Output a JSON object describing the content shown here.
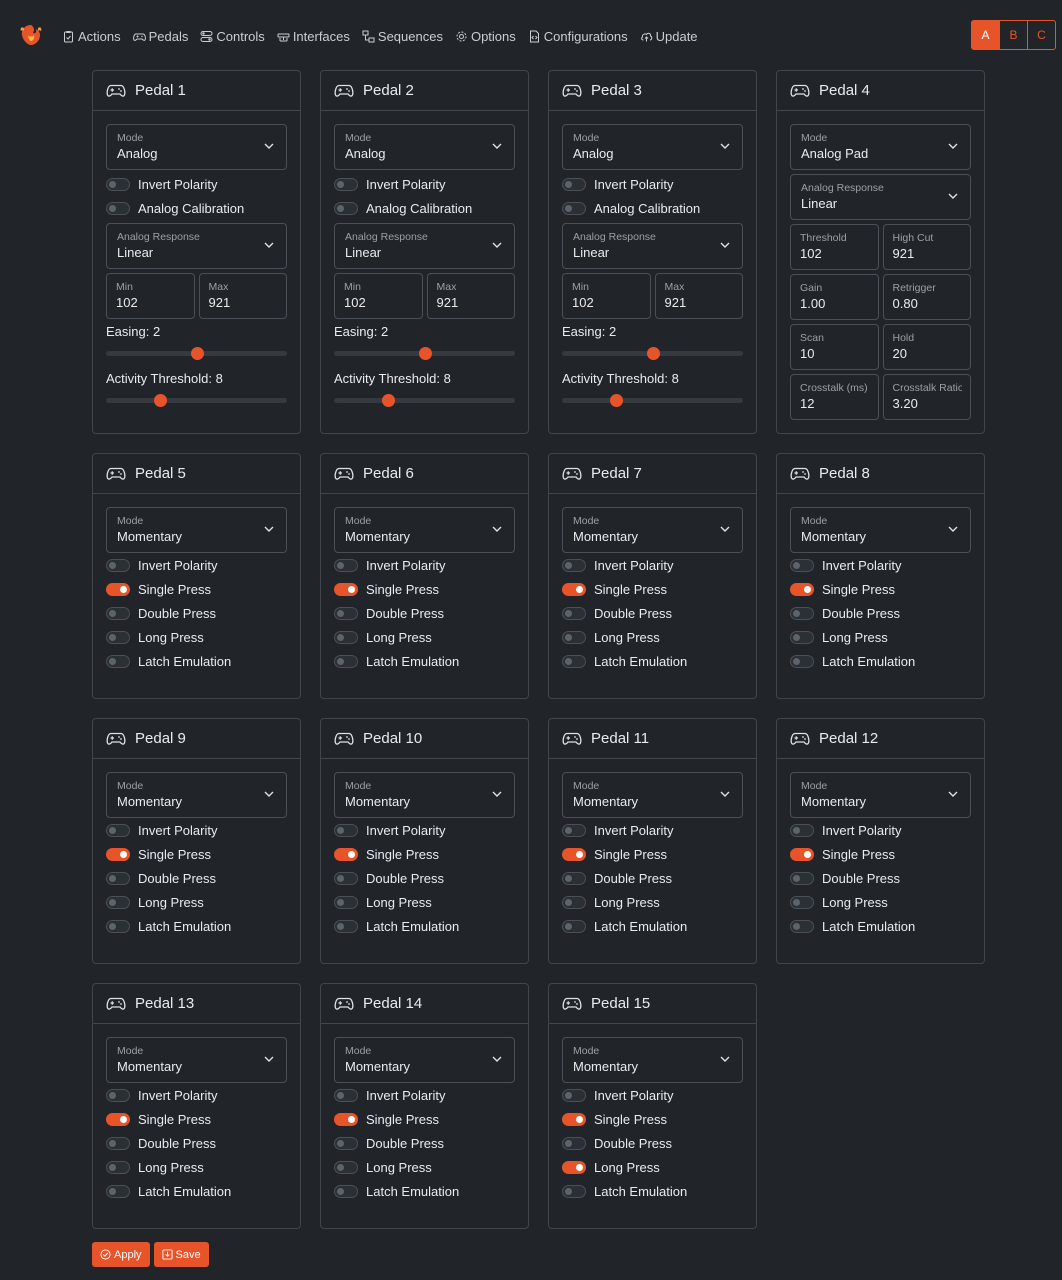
{
  "nav": {
    "items": [
      {
        "label": "Actions",
        "icon": "clipboard-icon"
      },
      {
        "label": "Pedals",
        "icon": "gamepad-icon"
      },
      {
        "label": "Controls",
        "icon": "toggles-icon"
      },
      {
        "label": "Interfaces",
        "icon": "router-icon"
      },
      {
        "label": "Sequences",
        "icon": "diagram-icon"
      },
      {
        "label": "Options",
        "icon": "gear-icon"
      },
      {
        "label": "Configurations",
        "icon": "file-code-icon"
      },
      {
        "label": "Update",
        "icon": "cloud-upload-icon"
      }
    ],
    "profiles": [
      "A",
      "B",
      "C"
    ],
    "active_profile": "A"
  },
  "accent_color": "#e8542a",
  "pedals": [
    {
      "title": "Pedal 1",
      "mode_label": "Mode",
      "mode": "Analog",
      "switches": [
        {
          "label": "Invert Polarity",
          "on": false
        },
        {
          "label": "Analog Calibration",
          "on": false
        }
      ],
      "response_label": "Analog Response",
      "response": "Linear",
      "min_label": "Min",
      "min": "102",
      "max_label": "Max",
      "max": "921",
      "easing_label": "Easing: 2",
      "easing": 0.5,
      "activity_label": "Activity Threshold: 8",
      "activity": 0.3
    },
    {
      "title": "Pedal 2",
      "mode_label": "Mode",
      "mode": "Analog",
      "switches": [
        {
          "label": "Invert Polarity",
          "on": false
        },
        {
          "label": "Analog Calibration",
          "on": false
        }
      ],
      "response_label": "Analog Response",
      "response": "Linear",
      "min_label": "Min",
      "min": "102",
      "max_label": "Max",
      "max": "921",
      "easing_label": "Easing: 2",
      "easing": 0.5,
      "activity_label": "Activity Threshold: 8",
      "activity": 0.3
    },
    {
      "title": "Pedal 3",
      "mode_label": "Mode",
      "mode": "Analog",
      "switches": [
        {
          "label": "Invert Polarity",
          "on": false
        },
        {
          "label": "Analog Calibration",
          "on": false
        }
      ],
      "response_label": "Analog Response",
      "response": "Linear",
      "min_label": "Min",
      "min": "102",
      "max_label": "Max",
      "max": "921",
      "easing_label": "Easing: 2",
      "easing": 0.5,
      "activity_label": "Activity Threshold: 8",
      "activity": 0.3
    },
    {
      "title": "Pedal 4",
      "mode_label": "Mode",
      "mode": "Analog Pad",
      "response_label": "Analog Response",
      "response": "Linear",
      "pad_fields": [
        {
          "label": "Threshold",
          "value": "102"
        },
        {
          "label": "High Cut",
          "value": "921"
        },
        {
          "label": "Gain",
          "value": "1.00"
        },
        {
          "label": "Retrigger",
          "value": "0.80"
        },
        {
          "label": "Scan",
          "value": "10"
        },
        {
          "label": "Hold",
          "value": "20"
        },
        {
          "label": "Crosstalk (ms)",
          "value": "12"
        },
        {
          "label": "Crosstalk Ratio",
          "value": "3.20"
        }
      ]
    },
    {
      "title": "Pedal 5",
      "mode_label": "Mode",
      "mode": "Momentary",
      "switches": [
        {
          "label": "Invert Polarity",
          "on": false
        },
        {
          "label": "Single Press",
          "on": true
        },
        {
          "label": "Double Press",
          "on": false
        },
        {
          "label": "Long Press",
          "on": false
        },
        {
          "label": "Latch Emulation",
          "on": false
        }
      ]
    },
    {
      "title": "Pedal 6",
      "mode_label": "Mode",
      "mode": "Momentary",
      "switches": [
        {
          "label": "Invert Polarity",
          "on": false
        },
        {
          "label": "Single Press",
          "on": true
        },
        {
          "label": "Double Press",
          "on": false
        },
        {
          "label": "Long Press",
          "on": false
        },
        {
          "label": "Latch Emulation",
          "on": false
        }
      ]
    },
    {
      "title": "Pedal 7",
      "mode_label": "Mode",
      "mode": "Momentary",
      "switches": [
        {
          "label": "Invert Polarity",
          "on": false
        },
        {
          "label": "Single Press",
          "on": true
        },
        {
          "label": "Double Press",
          "on": false
        },
        {
          "label": "Long Press",
          "on": false
        },
        {
          "label": "Latch Emulation",
          "on": false
        }
      ]
    },
    {
      "title": "Pedal 8",
      "mode_label": "Mode",
      "mode": "Momentary",
      "switches": [
        {
          "label": "Invert Polarity",
          "on": false
        },
        {
          "label": "Single Press",
          "on": true
        },
        {
          "label": "Double Press",
          "on": false
        },
        {
          "label": "Long Press",
          "on": false
        },
        {
          "label": "Latch Emulation",
          "on": false
        }
      ]
    },
    {
      "title": "Pedal 9",
      "mode_label": "Mode",
      "mode": "Momentary",
      "switches": [
        {
          "label": "Invert Polarity",
          "on": false
        },
        {
          "label": "Single Press",
          "on": true
        },
        {
          "label": "Double Press",
          "on": false
        },
        {
          "label": "Long Press",
          "on": false
        },
        {
          "label": "Latch Emulation",
          "on": false
        }
      ]
    },
    {
      "title": "Pedal 10",
      "mode_label": "Mode",
      "mode": "Momentary",
      "switches": [
        {
          "label": "Invert Polarity",
          "on": false
        },
        {
          "label": "Single Press",
          "on": true
        },
        {
          "label": "Double Press",
          "on": false
        },
        {
          "label": "Long Press",
          "on": false
        },
        {
          "label": "Latch Emulation",
          "on": false
        }
      ]
    },
    {
      "title": "Pedal 11",
      "mode_label": "Mode",
      "mode": "Momentary",
      "switches": [
        {
          "label": "Invert Polarity",
          "on": false
        },
        {
          "label": "Single Press",
          "on": true
        },
        {
          "label": "Double Press",
          "on": false
        },
        {
          "label": "Long Press",
          "on": false
        },
        {
          "label": "Latch Emulation",
          "on": false
        }
      ]
    },
    {
      "title": "Pedal 12",
      "mode_label": "Mode",
      "mode": "Momentary",
      "switches": [
        {
          "label": "Invert Polarity",
          "on": false
        },
        {
          "label": "Single Press",
          "on": true
        },
        {
          "label": "Double Press",
          "on": false
        },
        {
          "label": "Long Press",
          "on": false
        },
        {
          "label": "Latch Emulation",
          "on": false
        }
      ]
    },
    {
      "title": "Pedal 13",
      "mode_label": "Mode",
      "mode": "Momentary",
      "switches": [
        {
          "label": "Invert Polarity",
          "on": false
        },
        {
          "label": "Single Press",
          "on": true
        },
        {
          "label": "Double Press",
          "on": false
        },
        {
          "label": "Long Press",
          "on": false
        },
        {
          "label": "Latch Emulation",
          "on": false
        }
      ]
    },
    {
      "title": "Pedal 14",
      "mode_label": "Mode",
      "mode": "Momentary",
      "switches": [
        {
          "label": "Invert Polarity",
          "on": false
        },
        {
          "label": "Single Press",
          "on": true
        },
        {
          "label": "Double Press",
          "on": false
        },
        {
          "label": "Long Press",
          "on": false
        },
        {
          "label": "Latch Emulation",
          "on": false
        }
      ]
    },
    {
      "title": "Pedal 15",
      "mode_label": "Mode",
      "mode": "Momentary",
      "switches": [
        {
          "label": "Invert Polarity",
          "on": false
        },
        {
          "label": "Single Press",
          "on": true
        },
        {
          "label": "Double Press",
          "on": false
        },
        {
          "label": "Long Press",
          "on": true
        },
        {
          "label": "Latch Emulation",
          "on": false
        }
      ]
    }
  ],
  "footer": {
    "apply_label": "Apply",
    "save_label": "Save"
  }
}
